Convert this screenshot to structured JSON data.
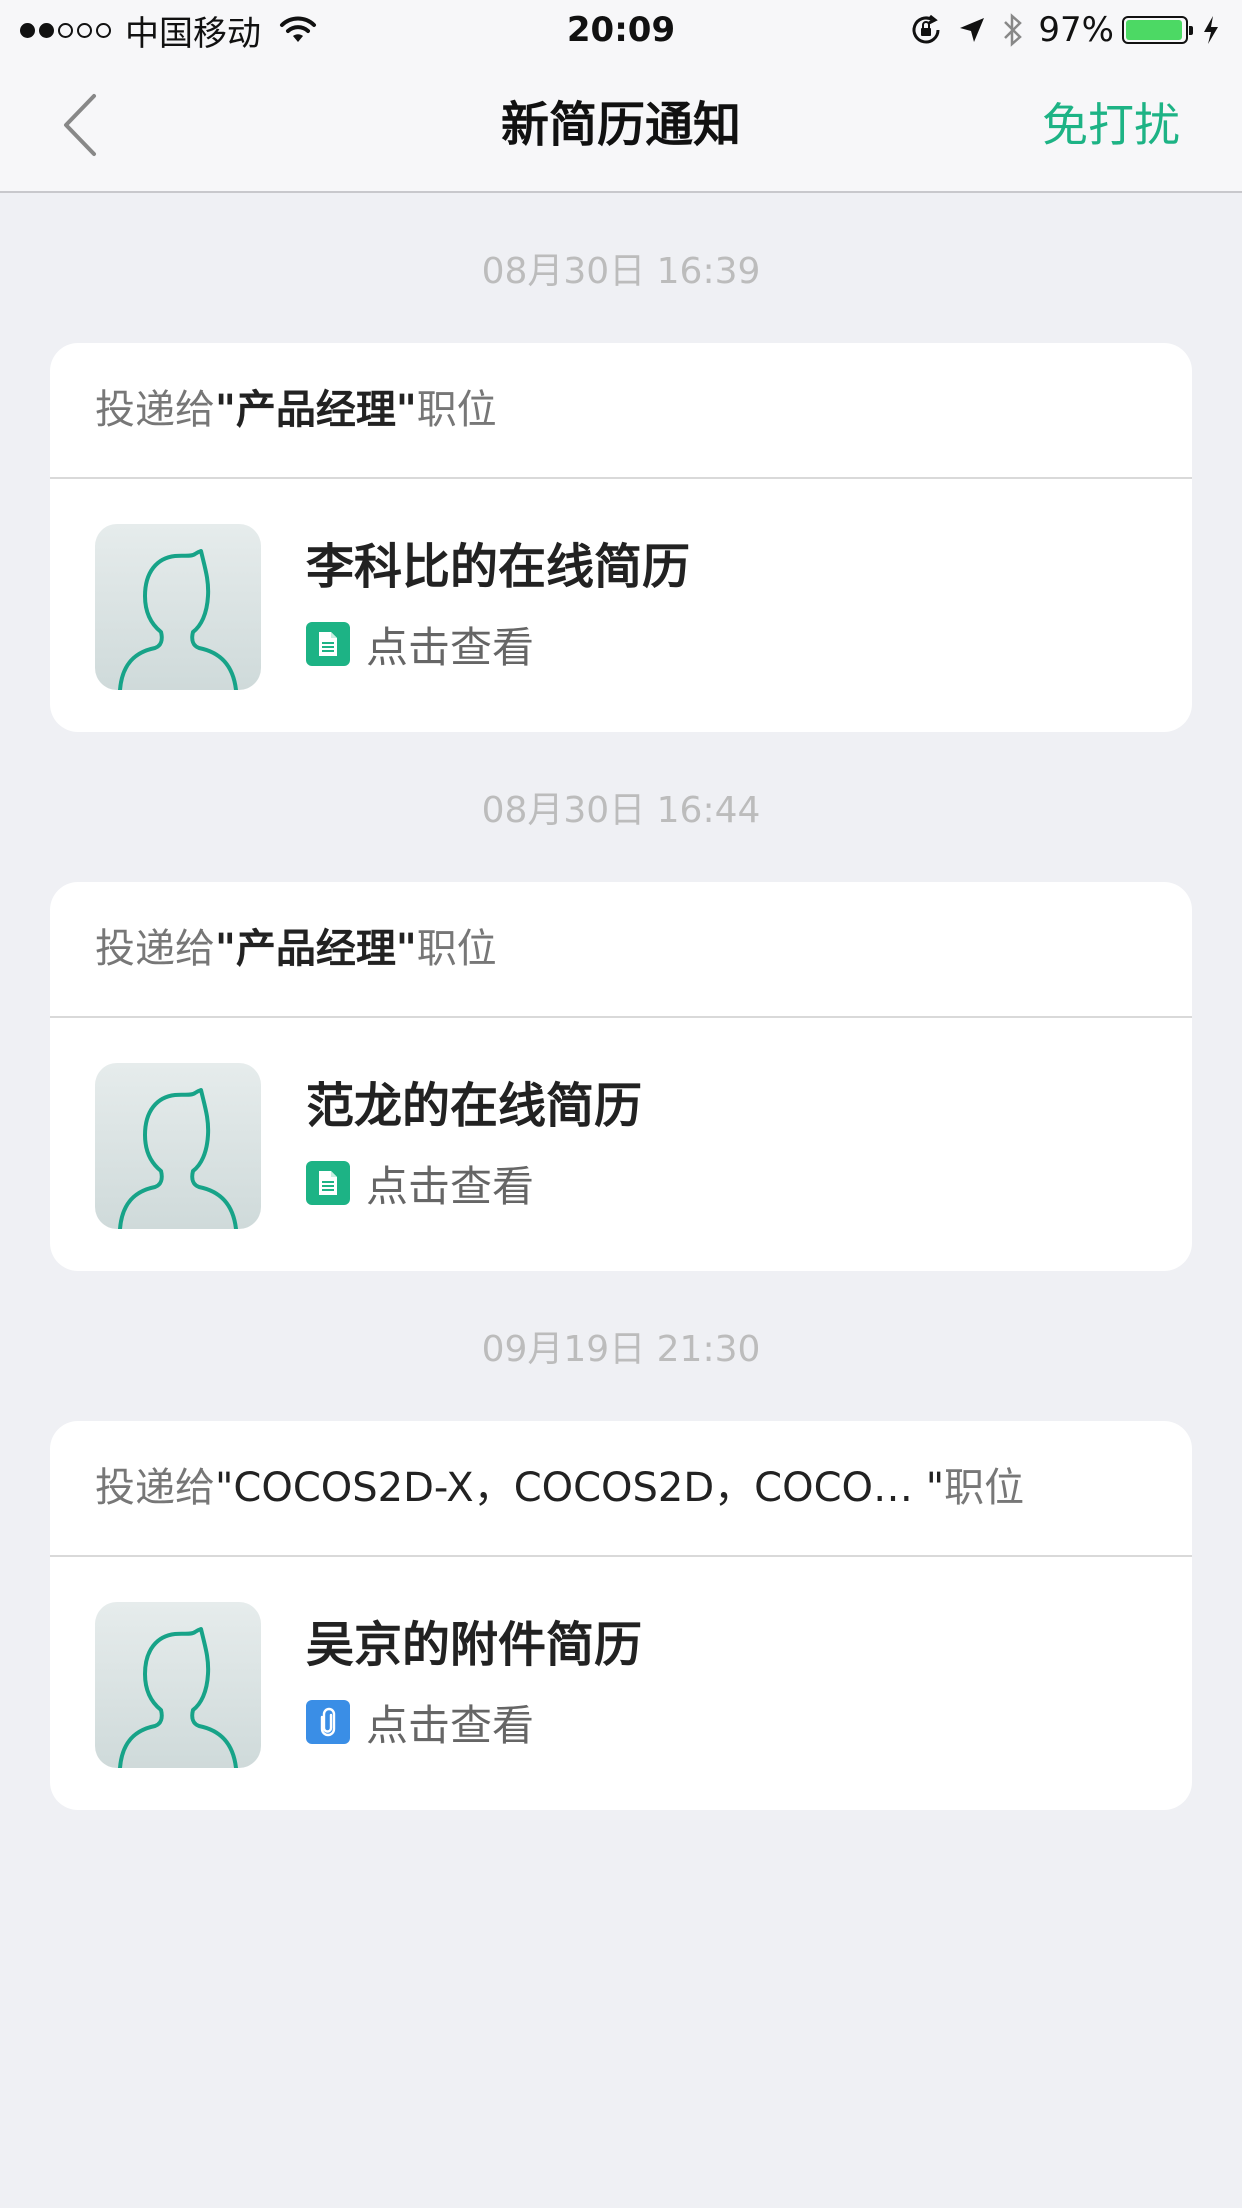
{
  "status_bar": {
    "carrier": "中国移动",
    "time": "20:09",
    "battery_percent_text": "97%",
    "battery_level": 0.97,
    "signal_bars": 2,
    "signal_total": 5,
    "icons": [
      "wifi-icon",
      "orientation-lock-icon",
      "location-arrow-icon",
      "bluetooth-icon",
      "battery-icon",
      "charging-bolt-icon"
    ]
  },
  "nav": {
    "back_icon": "chevron-left-icon",
    "title": "新简历通知",
    "right_action": "免打扰"
  },
  "colors": {
    "accent": "#1db385",
    "background": "#eff0f4",
    "online_resume_icon": "#1db385",
    "attachment_icon": "#3a8ee6",
    "battery_fill": "#4cd964"
  },
  "notifications": [
    {
      "timestamp": "08月30日 16:39",
      "header_prefix": "投递给",
      "job": "\"产品经理\"",
      "header_suffix": "职位",
      "title": "李科比的在线简历",
      "action": "点击查看",
      "icon": "document-icon"
    },
    {
      "timestamp": "08月30日 16:44",
      "header_prefix": "投递给",
      "job": "\"产品经理\"",
      "header_suffix": "职位",
      "title": "范龙的在线简历",
      "action": "点击查看",
      "icon": "document-icon"
    },
    {
      "timestamp": "09月19日 21:30",
      "header_prefix": "投递给",
      "job": "\"COCOS2D-X，COCOS2D，COCO… \"",
      "header_suffix": "职位",
      "title": "吴京的附件简历",
      "action": "点击查看",
      "icon": "paperclip-icon"
    }
  ]
}
